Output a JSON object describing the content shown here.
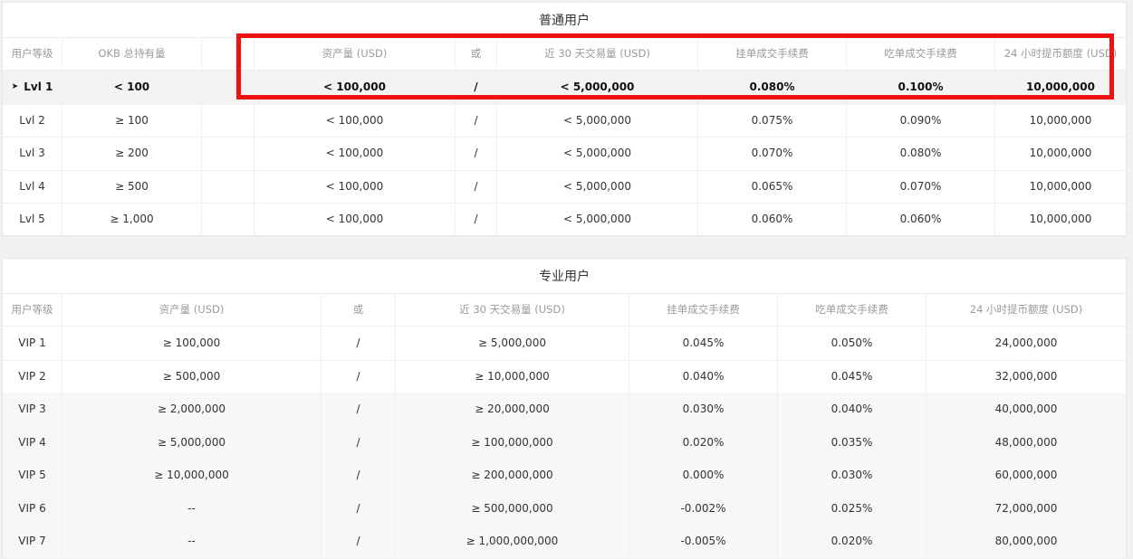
{
  "regular": {
    "title": "普通用户",
    "headers": [
      "用户等级",
      "OKB 总持有量",
      "",
      "资产量 (USD)",
      "或",
      "近 30 天交易量 (USD)",
      "挂单成交手续费",
      "吃单成交手续费",
      "24 小时提币额度 (USD)"
    ],
    "rows": [
      {
        "level": "Lvl 1",
        "okb": "< 100",
        "assets": "< 100,000",
        "or": "/",
        "volume": "< 5,000,000",
        "maker": "0.080%",
        "taker": "0.100%",
        "limit": "10,000,000"
      },
      {
        "level": "Lvl 2",
        "okb": "≥ 100",
        "assets": "< 100,000",
        "or": "/",
        "volume": "< 5,000,000",
        "maker": "0.075%",
        "taker": "0.090%",
        "limit": "10,000,000"
      },
      {
        "level": "Lvl 3",
        "okb": "≥ 200",
        "assets": "< 100,000",
        "or": "/",
        "volume": "< 5,000,000",
        "maker": "0.070%",
        "taker": "0.080%",
        "limit": "10,000,000"
      },
      {
        "level": "Lvl 4",
        "okb": "≥ 500",
        "assets": "< 100,000",
        "or": "/",
        "volume": "< 5,000,000",
        "maker": "0.065%",
        "taker": "0.070%",
        "limit": "10,000,000"
      },
      {
        "level": "Lvl 5",
        "okb": "≥ 1,000",
        "assets": "< 100,000",
        "or": "/",
        "volume": "< 5,000,000",
        "maker": "0.060%",
        "taker": "0.060%",
        "limit": "10,000,000"
      }
    ]
  },
  "pro": {
    "title": "专业用户",
    "headers": [
      "用户等级",
      "资产量 (USD)",
      "或",
      "近 30 天交易量 (USD)",
      "挂单成交手续费",
      "吃单成交手续费",
      "24 小时提币额度 (USD)"
    ],
    "rows": [
      {
        "level": "VIP 1",
        "assets": "≥ 100,000",
        "or": "/",
        "volume": "≥ 5,000,000",
        "maker": "0.045%",
        "taker": "0.050%",
        "limit": "24,000,000"
      },
      {
        "level": "VIP 2",
        "assets": "≥ 500,000",
        "or": "/",
        "volume": "≥ 10,000,000",
        "maker": "0.040%",
        "taker": "0.045%",
        "limit": "32,000,000"
      },
      {
        "level": "VIP 3",
        "assets": "≥ 2,000,000",
        "or": "/",
        "volume": "≥ 20,000,000",
        "maker": "0.030%",
        "taker": "0.040%",
        "limit": "40,000,000"
      },
      {
        "level": "VIP 4",
        "assets": "≥ 5,000,000",
        "or": "/",
        "volume": "≥ 100,000,000",
        "maker": "0.020%",
        "taker": "0.035%",
        "limit": "48,000,000"
      },
      {
        "level": "VIP 5",
        "assets": "≥ 10,000,000",
        "or": "/",
        "volume": "≥ 200,000,000",
        "maker": "0.000%",
        "taker": "0.030%",
        "limit": "60,000,000"
      },
      {
        "level": "VIP 6",
        "assets": "--",
        "or": "/",
        "volume": "≥ 500,000,000",
        "maker": "-0.002%",
        "taker": "0.025%",
        "limit": "72,000,000"
      },
      {
        "level": "VIP 7",
        "assets": "--",
        "or": "/",
        "volume": "≥ 1,000,000,000",
        "maker": "-0.005%",
        "taker": "0.020%",
        "limit": "80,000,000"
      }
    ]
  },
  "highlight": {
    "color": "#ee1111",
    "selected_row": "Lvl 1",
    "marker_icon": "triangle-right-icon"
  }
}
